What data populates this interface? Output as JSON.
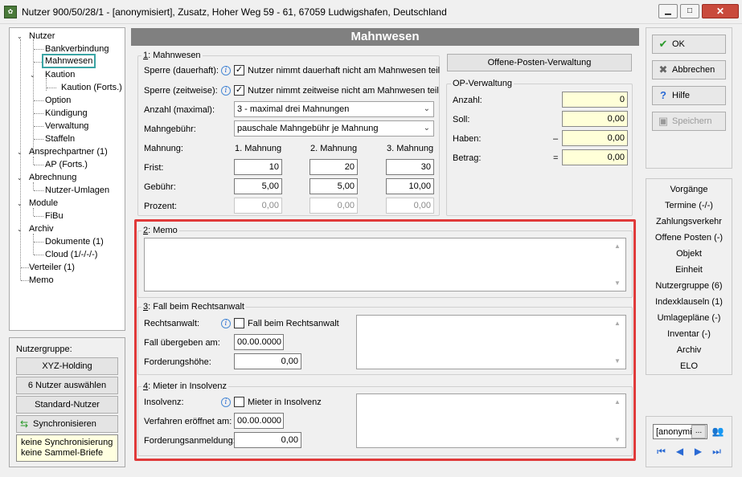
{
  "window": {
    "title": "Nutzer 900/50/28/1 - [anonymisiert], Zusatz, Hoher Weg 59 - 61, 67059 Ludwigshafen, Deutschland",
    "minimize": "▁",
    "maximize": "□",
    "close": "✕"
  },
  "tree": {
    "items": [
      {
        "label": "Nutzer"
      },
      {
        "label": "Bankverbindung"
      },
      {
        "label": "Mahnwesen"
      },
      {
        "label": "Kaution"
      },
      {
        "label": "Kaution (Forts.)"
      },
      {
        "label": "Option"
      },
      {
        "label": "Kündigung"
      },
      {
        "label": "Verwaltung"
      },
      {
        "label": "Staffeln"
      },
      {
        "label": "Ansprechpartner (1)"
      },
      {
        "label": "AP (Forts.)"
      },
      {
        "label": "Abrechnung"
      },
      {
        "label": "Nutzer-Umlagen"
      },
      {
        "label": "Module"
      },
      {
        "label": "FiBu"
      },
      {
        "label": "Archiv"
      },
      {
        "label": "Dokumente (1)"
      },
      {
        "label": "Cloud (1/-/-/-)"
      },
      {
        "label": "Verteiler (1)"
      },
      {
        "label": "Memo"
      }
    ]
  },
  "nutzergruppe": {
    "label": "Nutzergruppe:",
    "group_button": "XYZ-Holding",
    "select_button": "6 Nutzer auswählen",
    "standard_button": "Standard-Nutzer",
    "sync_button": "Synchronisieren",
    "note_line1": "keine Synchronisierung",
    "note_line2": "keine Sammel-Briefe"
  },
  "header": {
    "title": "Mahnwesen"
  },
  "mahnwesen": {
    "section_num": "1",
    "section_title": ": Mahnwesen",
    "sperre_dauerhaft_label": "Sperre (dauerhaft):",
    "sperre_dauerhaft_text": "Nutzer nimmt dauerhaft nicht am Mahnwesen teil",
    "sperre_zeitweise_label": "Sperre (zeitweise):",
    "sperre_zeitweise_text": "Nutzer nimmt zeitweise nicht am Mahnwesen teil",
    "anzahl_label": "Anzahl (maximal):",
    "anzahl_value": "3 - maximal drei Mahnungen",
    "gebuehr_label": "Mahngebühr:",
    "gebuehr_value": "pauschale Mahngebühr je Mahnung",
    "mahnung_label": "Mahnung:",
    "col1": "1. Mahnung",
    "col2": "2. Mahnung",
    "col3": "3. Mahnung",
    "frist_label": "Frist:",
    "frist": [
      "10",
      "20",
      "30"
    ],
    "gebuehr_row_label": "Gebühr:",
    "gebuehr_row": [
      "5,00",
      "5,00",
      "10,00"
    ],
    "prozent_label": "Prozent:",
    "prozent": [
      "0,00",
      "0,00",
      "0,00"
    ]
  },
  "op": {
    "button": "Offene-Posten-Verwaltung",
    "group_title": "OP-Verwaltung",
    "anzahl_label": "Anzahl:",
    "anzahl": "0",
    "soll_label": "Soll:",
    "soll": "0,00",
    "haben_label": "Haben:",
    "haben_sign": "–",
    "haben": "0,00",
    "betrag_label": "Betrag:",
    "betrag_sign": "=",
    "betrag": "0,00"
  },
  "memo": {
    "section_num": "2",
    "section_title": ": Memo",
    "text": ""
  },
  "anwalt": {
    "section_num": "3",
    "section_title": ": Fall beim Rechtsanwalt",
    "label": "Rechtsanwalt:",
    "checkbox_text": "Fall beim Rechtsanwalt",
    "date_label": "Fall übergeben am:",
    "date_value": "00.00.0000",
    "forderung_label": "Forderungshöhe:",
    "forderung_value": "0,00"
  },
  "insolvenz": {
    "section_num": "4",
    "section_title": ": Mieter in Insolvenz",
    "label": "Insolvenz:",
    "checkbox_text": "Mieter in Insolvenz",
    "date_label": "Verfahren eröffnet am:",
    "date_value": "00.00.0000",
    "forderung_label": "Forderungsanmeldung:",
    "forderung_value": "0,00"
  },
  "actions": {
    "ok": "OK",
    "cancel": "Abbrechen",
    "help": "Hilfe",
    "save": "Speichern"
  },
  "links": [
    "Vorgänge",
    "Termine (-/-)",
    "Zahlungsverkehr",
    "Offene Posten (-)",
    "Objekt",
    "Einheit",
    "Nutzergruppe (6)",
    "Indexklauseln (1)",
    "Umlagepläne (-)",
    "Inventar (-)",
    "Archiv",
    "ELO"
  ],
  "navigator": {
    "field_value": "[anonymi",
    "dots": "..."
  },
  "colors": {
    "highlight_red": "#e03a3a",
    "header_gray": "#808080",
    "note_yellow": "#ffffe0",
    "tree_selection": "#3aa4a4"
  },
  "icons": {
    "ok": "check-icon",
    "cancel": "x-icon",
    "help": "question-icon",
    "save": "floppy-icon",
    "info": "info-icon",
    "sync": "sync-arrows-icon"
  }
}
